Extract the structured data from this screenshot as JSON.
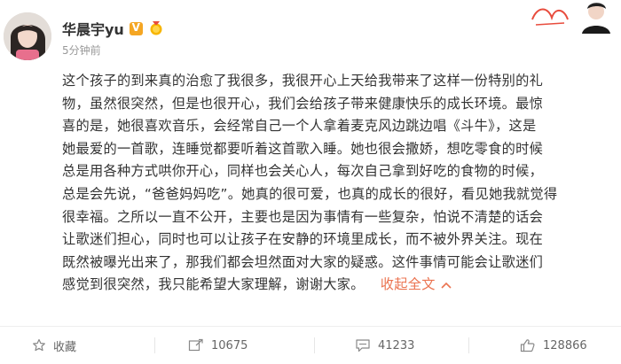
{
  "post": {
    "username": "华晨宇yu",
    "time": "5分钟前",
    "content_lines": [
      "这个孩子的到来真的治愈了我很多，我很开心上天给我带来了这样一份特别的礼",
      "物，虽然很突然，但是也很开心，我们会给孩子带来健康快乐的成长环境。最惊",
      "喜的是，她很喜欢音乐，会经常自己一个人拿着麦克风边跳边唱《斗牛》，这是",
      "她最爱的一首歌，连睡觉都要听着这首歌入睡。她也很会撒娇，想吃零食的时候",
      "总是用各种方式哄你开心，同样也会关心人，每次自己拿到好吃的食物的时候，",
      "总是会先说，“爸爸妈妈吃”。她真的很可爱，也真的成长的很好，看见她我就觉得",
      "很幸福。之所以一直不公开，主要也是因为事情有一些复杂，怕说不清楚的话会",
      "让歌迷们担心，同时也可以让孩子在安静的环境里成长，而不被外界关注。现在",
      "既然被曝光出来了，那我们都会坦然面对大家的疑惑。这件事情可能会让歌迷们",
      "感觉到很突然，我只能希望大家理解，谢谢大家。"
    ],
    "collapse_label": "收起全文"
  },
  "actions": {
    "favorite_label": "收藏",
    "repost_count": "10675",
    "comment_count": "41233",
    "like_count": "128866"
  },
  "icons": {
    "verified": "verified-v-badge-icon",
    "medal": "medal-icon",
    "favorite": "star-icon",
    "repost": "repost-icon",
    "comment": "comment-icon",
    "like": "thumbs-up-icon",
    "collapse": "chevron-up-icon"
  },
  "colors": {
    "accent": "#eb7350",
    "badge": "#f5a623",
    "text": "#333333",
    "muted": "#999999"
  }
}
